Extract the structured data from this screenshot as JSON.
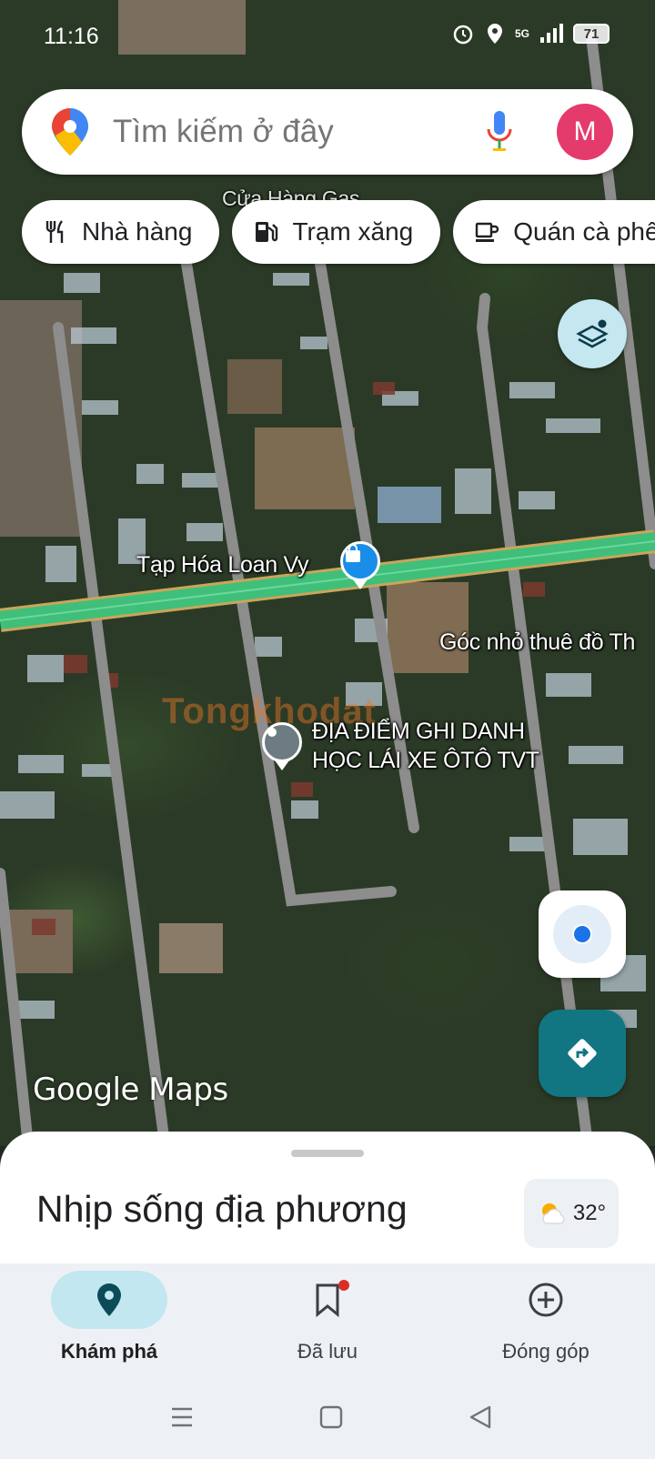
{
  "status_bar": {
    "time": "11:16",
    "network": "5G",
    "battery": "71"
  },
  "search": {
    "placeholder": "Tìm kiếm ở đây",
    "avatar_letter": "M"
  },
  "chips": [
    {
      "label": "Nhà hàng",
      "icon": "restaurant-icon"
    },
    {
      "label": "Trạm xăng",
      "icon": "gas-station-icon"
    },
    {
      "label": "Quán cà phê",
      "icon": "coffee-icon"
    }
  ],
  "map": {
    "labels": {
      "partial_top": "Cửa Hàng Gas",
      "tap_hoa": "Tạp Hóa Loan Vy",
      "goc_nho": "Góc nhỏ thuê đồ Th",
      "dia_diem_line1": "ĐỊA ĐIỂM GHI DANH",
      "dia_diem_line2": "HỌC LÁI XE ÔTÔ TVT"
    },
    "watermark": "Tongkhodat",
    "logo": "Google Maps",
    "map_type": "satellite"
  },
  "sheet": {
    "title": "Nhịp sống địa phương",
    "temperature": "32°",
    "weather_icon": "partly-cloudy-icon"
  },
  "bottom_nav": {
    "items": [
      {
        "label": "Khám phá",
        "icon": "explore-pin-icon",
        "active": true
      },
      {
        "label": "Đã lưu",
        "icon": "saved-bookmark-icon",
        "active": false
      },
      {
        "label": "Đóng góp",
        "icon": "contribute-plus-icon",
        "active": false
      }
    ]
  },
  "colors": {
    "accent_teal": "#117582",
    "highway": "#3fbf7a",
    "avatar": "#e53a6c",
    "location_blue": "#1a73e8"
  }
}
